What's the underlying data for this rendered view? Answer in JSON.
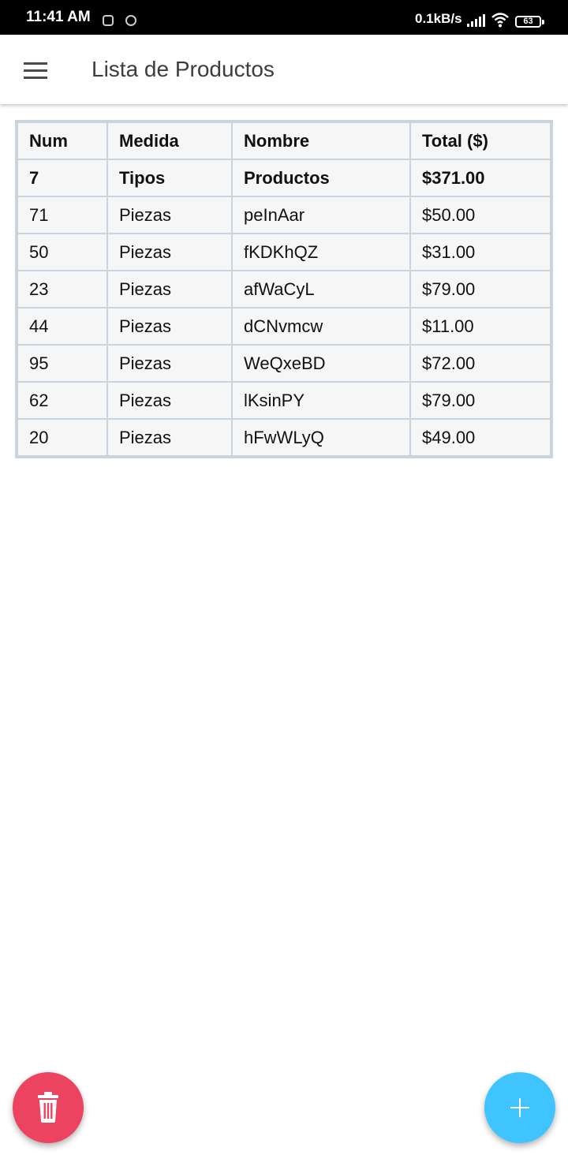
{
  "status_bar": {
    "time": "11:41 AM",
    "net_speed": "0.1kB/s",
    "battery": "63",
    "icons": [
      "notification-icon",
      "notification-icon",
      "signal-icon",
      "wifi-icon",
      "battery-icon"
    ]
  },
  "app_bar": {
    "title": "Lista de Productos",
    "menu_icon": "menu-icon"
  },
  "table": {
    "headers": [
      "Num",
      "Medida",
      "Nombre",
      "Total ($)"
    ],
    "summary": [
      "7",
      "Tipos",
      "Productos",
      "$371.00"
    ],
    "rows": [
      [
        "71",
        "Piezas",
        "peInAar",
        "$50.00"
      ],
      [
        "50",
        "Piezas",
        "fKDKhQZ",
        "$31.00"
      ],
      [
        "23",
        "Piezas",
        "afWaCyL",
        "$79.00"
      ],
      [
        "44",
        "Piezas",
        "dCNvmcw",
        "$11.00"
      ],
      [
        "95",
        "Piezas",
        "WeQxeBD",
        "$72.00"
      ],
      [
        "62",
        "Piezas",
        "lKsinPY",
        "$79.00"
      ],
      [
        "20",
        "Piezas",
        "hFwWLyQ",
        "$49.00"
      ]
    ]
  },
  "fabs": {
    "delete_icon": "trash-icon",
    "add_icon": "plus-icon",
    "delete_color": "#ec4460",
    "add_color": "#40c4ff"
  }
}
